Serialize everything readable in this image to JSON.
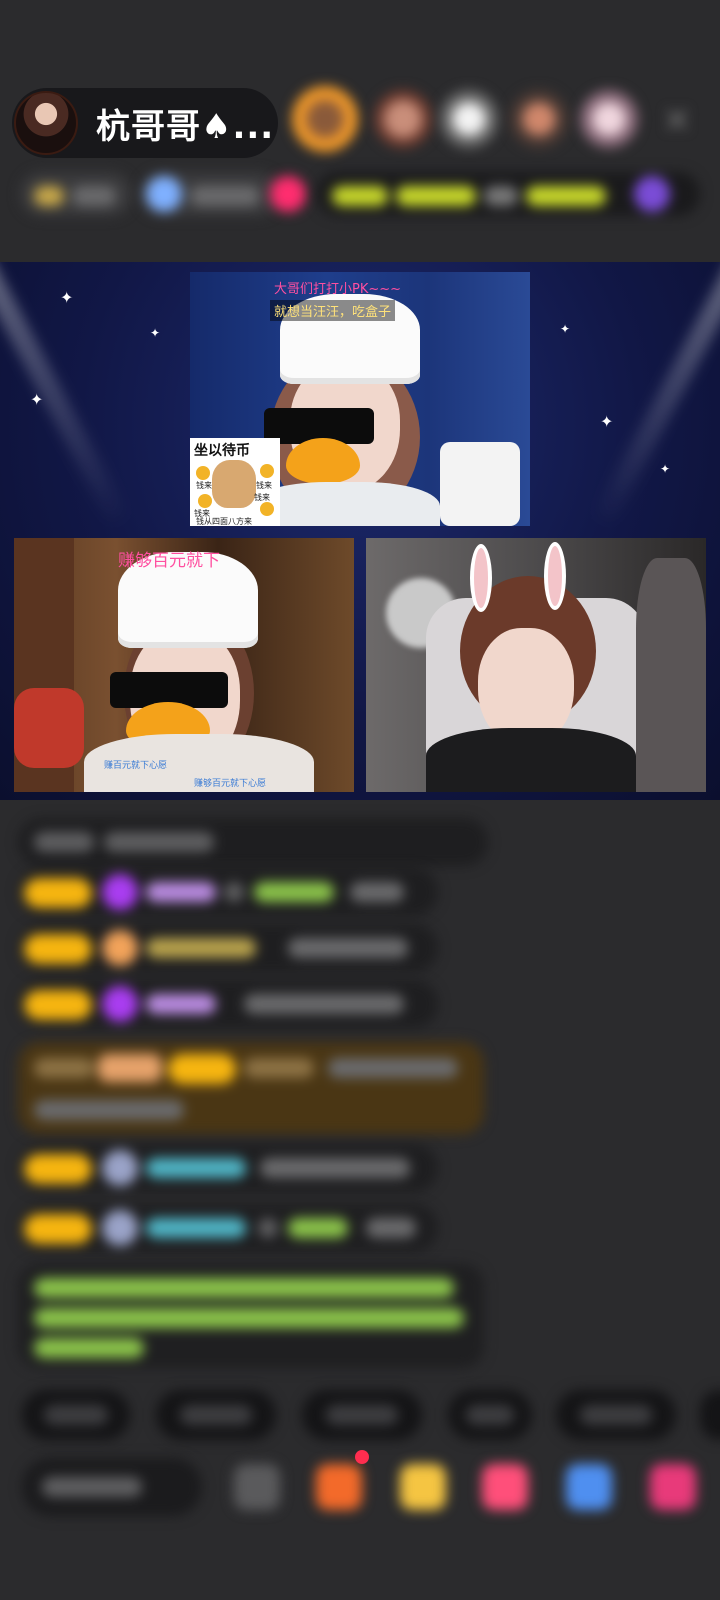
{
  "header": {
    "host_name": "杭哥哥♠...",
    "close_label": "✕"
  },
  "stage": {
    "top_overlay_line1": "大哥们打打小PK~~~",
    "top_overlay_line2": "就想当汪汪，吃盒子",
    "cat_card_title": "坐以待币",
    "cat_card_words": [
      "钱来",
      "钱来",
      "钱来",
      "钱来"
    ],
    "cat_card_footer": "钱从四面八方来",
    "left_overlay_title": "赚够百元就下",
    "left_overlay_bottom1": "赚百元就下心愿",
    "left_overlay_bottom2": "赚够百元就下心愿"
  },
  "colors": {
    "badge_yellow": "#f6b510",
    "chat_name_purple": "#b98be0",
    "chat_name_teal": "#4fb3c4",
    "chat_text_green": "#8bc34a",
    "accent_pink": "#ff2d6f"
  }
}
